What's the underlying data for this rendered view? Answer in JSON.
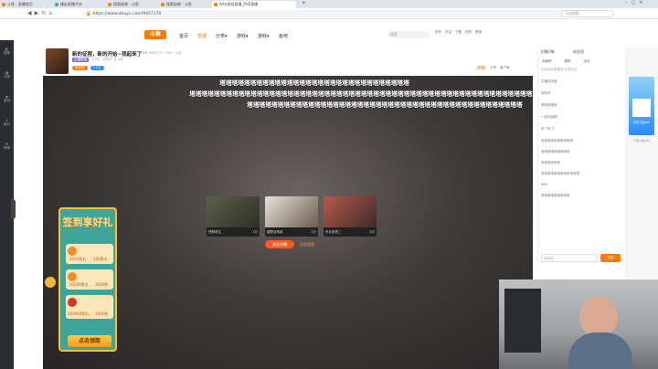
{
  "browser": {
    "tabs": [
      {
        "label": "斗鱼 · 直播首页",
        "color": "#ff7a00"
      },
      {
        "label": "精彩直播平台",
        "color": "#3cb371"
      },
      {
        "label": "搜索结果 · 斗鱼",
        "color": "#ff7a00"
      },
      {
        "label": "搜索结果 · 斗鱼",
        "color": "#ff7a00"
      },
      {
        "label": "AAA游戏直播_PVE直播",
        "color": "#ff7a00"
      }
    ],
    "new_tab": "+",
    "url": "https://www.douyu.com/9457170",
    "search_placeholder": "点击搜索"
  },
  "site": {
    "logo": "斗鱼",
    "nav": [
      "首页",
      "直播",
      "分类▾",
      "游戏▾",
      "游戏▾",
      "鱼吧"
    ],
    "search_placeholder": "搜索",
    "header_icons": [
      "历史",
      "关注",
      "下载",
      "任务",
      "登录"
    ],
    "rail": [
      "推荐",
      "分类",
      "游戏",
      "娱乐",
      "赛事"
    ]
  },
  "room": {
    "title": "新的征程，新的开始~我起来了",
    "meta": "房间号 9457170 · PVE · 公会",
    "tags": [
      "主播等级",
      "粉丝团"
    ],
    "stats": [
      "1.2万",
      "158万",
      "4.3万"
    ],
    "actions": [
      "举报",
      "分享",
      "客户端"
    ]
  },
  "danmu": [
    "塔塔塔塔塔塔塔塔塔塔塔塔塔塔塔塔塔塔塔塔塔塔塔塔塔塔塔塔塔塔塔",
    "塔塔塔塔塔塔塔塔塔塔塔塔塔塔塔塔塔塔塔塔塔塔塔塔塔塔塔塔塔塔塔塔塔塔塔塔塔塔塔塔塔塔塔塔塔塔塔塔塔塔塔塔塔塔塔塔塔塔塔塔塔",
    "塔塔塔塔塔塔塔塔塔塔塔塔塔塔塔塔塔塔塔塔塔塔塔塔塔塔塔塔塔塔塔塔塔塔塔塔塔塔塔塔塔塔塔塔塔"
  ],
  "recommend": {
    "cards": [
      {
        "name": "荒野求生",
        "count": "1万"
      },
      {
        "name": "越野自驾游",
        "count": "1万"
      },
      {
        "name": "东北老铁二",
        "count": "2万"
      }
    ],
    "follow_btn": "关注开播",
    "more_btn": "回到直播"
  },
  "signin": {
    "title": "签到享好礼",
    "rewards": [
      {
        "label": "2020鱼丸",
        "extra": "100鱼丸"
      },
      {
        "label": "20200鱼丸",
        "extra": "3000鱼"
      },
      {
        "label": "202000鱼丸",
        "extra": "1000鱼"
      }
    ],
    "button": "点击领取"
  },
  "chat": {
    "tabs": [
      "主播印象",
      "粉丝团"
    ],
    "subtabs": [
      "贡献榜",
      "周榜",
      "全站"
    ],
    "notice": "欢迎来到直播间,友善发言",
    "messages": [
      "主播真厉害",
      "好好好",
      "塔塔塔塔塔",
      "一起加油啊",
      "来了来了",
      "塔塔塔塔塔塔塔塔塔塔",
      "塔塔塔塔塔塔塔塔塔",
      "塔塔塔塔塔塔",
      "塔塔塔塔塔塔塔塔塔塔塔塔",
      "666",
      "塔塔塔塔塔塔塔塔塔"
    ],
    "input_placeholder": "发弹幕",
    "send": "发送"
  },
  "side_promo": {
    "label": "扫码下载APP",
    "caption": "下载斗鱼APP"
  },
  "colors": {
    "brand": "#ff7a00",
    "chat_badge": "#2a8cff",
    "sign_bg": "#3fa49a",
    "rail_bg": "#2b2d33"
  }
}
